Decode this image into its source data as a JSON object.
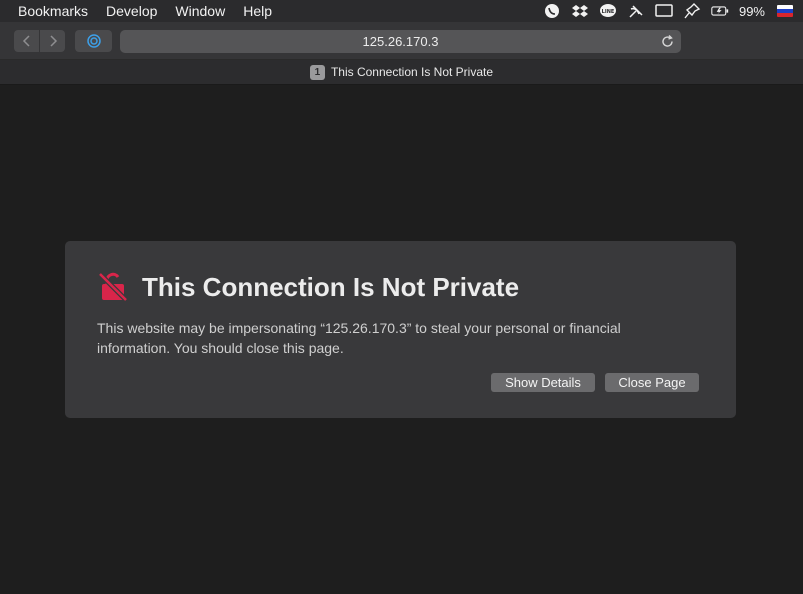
{
  "menubar": {
    "items": [
      "Bookmarks",
      "Develop",
      "Window",
      "Help"
    ],
    "status_icons": [
      "viber-icon",
      "dropbox-icon",
      "line-icon",
      "satellite-icon",
      "display-icon",
      "pin-icon",
      "battery-icon"
    ],
    "battery_percent": "99%",
    "flag": "russian-flag-icon"
  },
  "toolbar": {
    "back_icon": "chevron-left-icon",
    "forward_icon": "chevron-right-icon",
    "sidebar_icon": "sidebar-icon",
    "address": "125.26.170.3",
    "reload_icon": "reload-icon"
  },
  "tab": {
    "badge": "1",
    "title": "This Connection Is Not Private"
  },
  "warning": {
    "icon": "broken-lock-icon",
    "title": "This Connection Is Not Private",
    "body": "This website may be impersonating “125.26.170.3” to steal your personal or financial information. You should close this page.",
    "show_details_label": "Show Details",
    "close_page_label": "Close Page"
  },
  "colors": {
    "background": "#1e1e1e",
    "card": "#39393b",
    "warning_icon": "#d9254a",
    "button": "#6b6b6d"
  }
}
